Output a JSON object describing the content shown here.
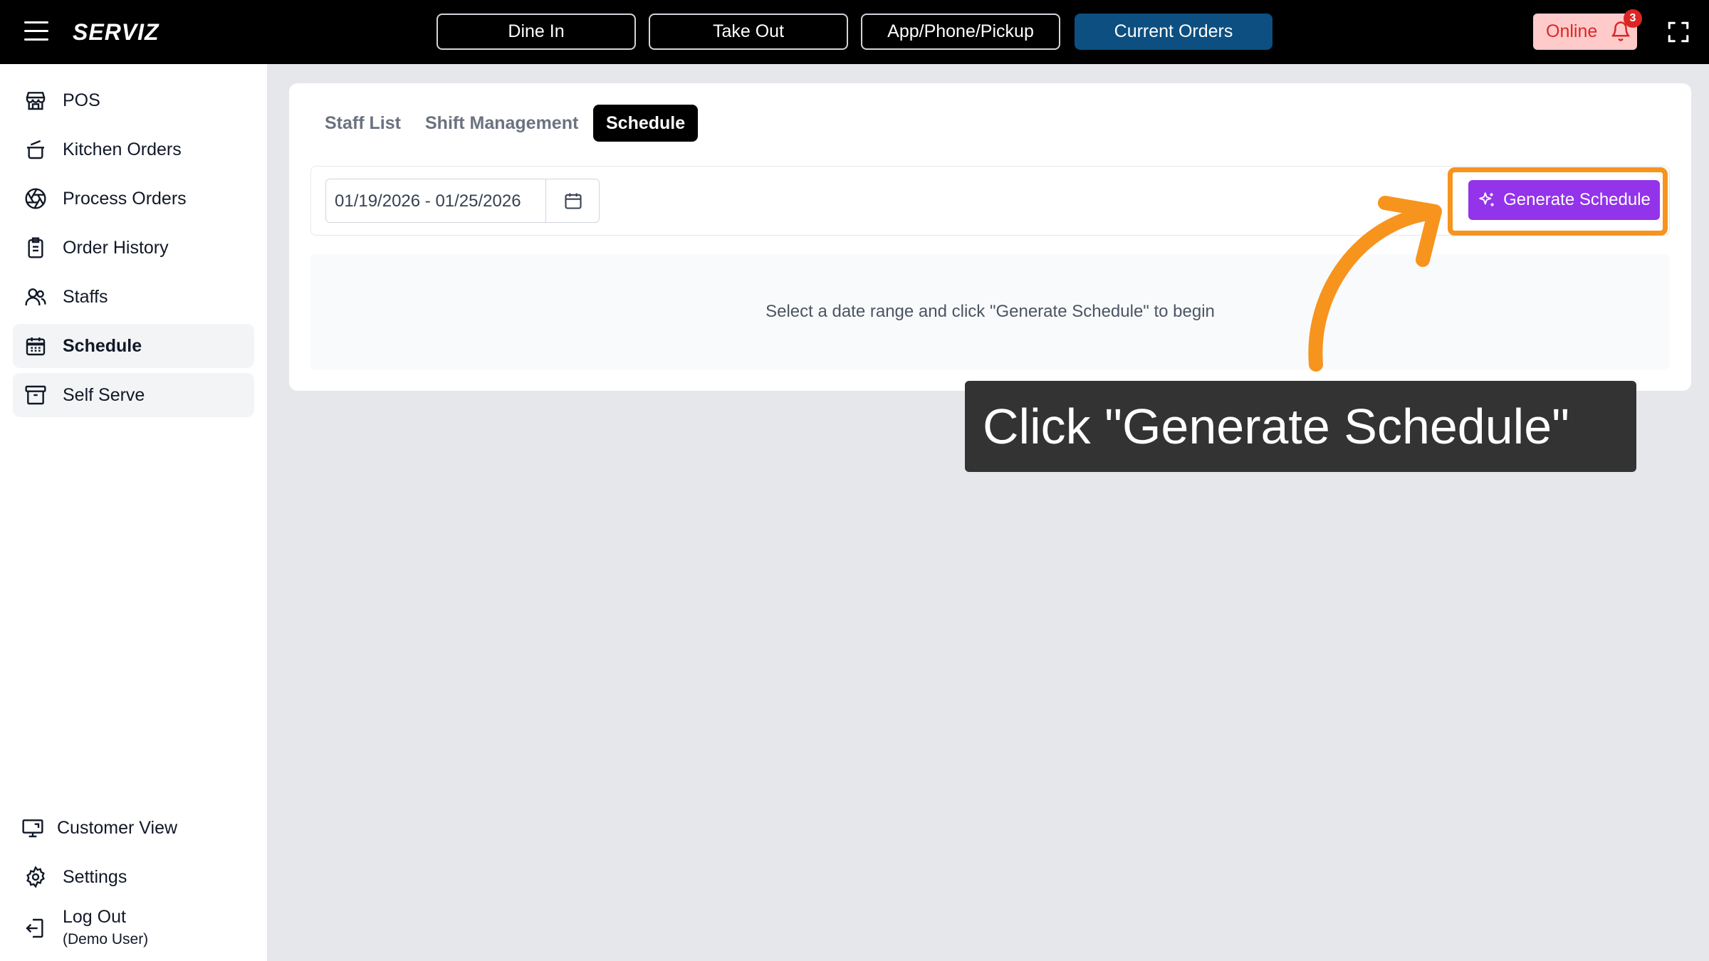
{
  "header": {
    "brand": "SERVIZ",
    "nav": [
      {
        "label": "Dine In",
        "active": false
      },
      {
        "label": "Take Out",
        "active": false
      },
      {
        "label": "App/Phone/Pickup",
        "active": false
      },
      {
        "label": "Current Orders",
        "active": true
      }
    ],
    "status_label": "Online",
    "notification_count": "3",
    "icons": {
      "menu": "hamburger-icon",
      "bell": "bell-icon",
      "fullscreen": "fullscreen-icon"
    }
  },
  "sidebar": {
    "items": [
      {
        "label": "POS",
        "icon": "store-icon"
      },
      {
        "label": "Kitchen Orders",
        "icon": "pot-icon"
      },
      {
        "label": "Process Orders",
        "icon": "aperture-icon"
      },
      {
        "label": "Order History",
        "icon": "clipboard-icon"
      },
      {
        "label": "Staffs",
        "icon": "users-icon"
      },
      {
        "label": "Schedule",
        "icon": "calendar-icon",
        "active": true
      },
      {
        "label": "Self Serve",
        "icon": "archive-icon"
      }
    ],
    "bottom": [
      {
        "label": "Customer View",
        "icon": "monitor-icon"
      },
      {
        "label": "Settings",
        "icon": "gear-icon"
      },
      {
        "label": "Log Out",
        "sub": "(Demo User)",
        "icon": "logout-icon"
      }
    ]
  },
  "main": {
    "tabs": [
      {
        "label": "Staff List",
        "active": false
      },
      {
        "label": "Shift Management",
        "active": false
      },
      {
        "label": "Schedule",
        "active": true
      }
    ],
    "date_range": "01/19/2026 - 01/25/2026",
    "generate_label": "Generate Schedule",
    "empty_message": "Select a date range and click \"Generate Schedule\" to begin"
  },
  "tooltip": {
    "text": "Click \"Generate Schedule\""
  },
  "colors": {
    "accent": "#0c4f80",
    "button": "#9333ea",
    "highlight": "#f7941d",
    "status_bg": "#fecaca",
    "status_text": "#dc2626"
  }
}
